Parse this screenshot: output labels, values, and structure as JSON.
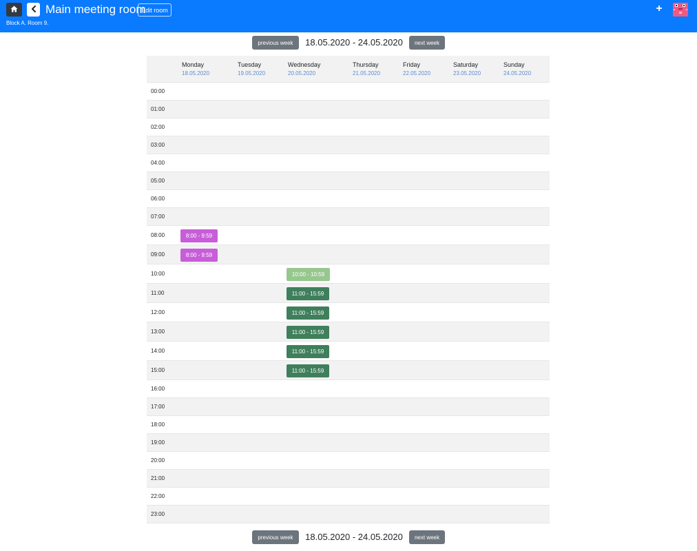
{
  "header": {
    "title": "Main meeting room",
    "edit_label": "Edit room",
    "subtitle": "Block A. Room 9.",
    "add_label": "+",
    "brand_color": "#0a7aff"
  },
  "week": {
    "range": "18.05.2020 - 24.05.2020",
    "prev_label": "previous week",
    "next_label": "next week"
  },
  "days": [
    {
      "name": "Monday",
      "date": "18.05.2020"
    },
    {
      "name": "Tuesday",
      "date": "19.05.2020"
    },
    {
      "name": "Wednesday",
      "date": "20.05.2020"
    },
    {
      "name": "Thursday",
      "date": "21.05.2020"
    },
    {
      "name": "Friday",
      "date": "22.05.2020"
    },
    {
      "name": "Saturday",
      "date": "23.05.2020"
    },
    {
      "name": "Sunday",
      "date": "24.05.2020"
    }
  ],
  "hours": [
    "00:00",
    "01:00",
    "02:00",
    "03:00",
    "04:00",
    "05:00",
    "06:00",
    "07:00",
    "08:00",
    "09:00",
    "10:00",
    "11:00",
    "12:00",
    "13:00",
    "14:00",
    "15:00",
    "16:00",
    "17:00",
    "18:00",
    "19:00",
    "20:00",
    "21:00",
    "22:00",
    "23:00"
  ],
  "events": [
    {
      "day": "Monday",
      "hour": "08:00",
      "label": "8:00 - 9:59",
      "color": "#c75ed8"
    },
    {
      "day": "Monday",
      "hour": "09:00",
      "label": "8:00 - 9:59",
      "color": "#c75ed8"
    },
    {
      "day": "Wednesday",
      "hour": "10:00",
      "label": "10:00 - 10:59",
      "color": "#97c78f"
    },
    {
      "day": "Wednesday",
      "hour": "11:00",
      "label": "11:00 - 15:59",
      "color": "#3f7f5b"
    },
    {
      "day": "Wednesday",
      "hour": "12:00",
      "label": "11:00 - 15:59",
      "color": "#3f7f5b"
    },
    {
      "day": "Wednesday",
      "hour": "13:00",
      "label": "11:00 - 15:59",
      "color": "#3f7f5b"
    },
    {
      "day": "Wednesday",
      "hour": "14:00",
      "label": "11:00 - 15:59",
      "color": "#3f7f5b"
    },
    {
      "day": "Wednesday",
      "hour": "15:00",
      "label": "11:00 - 15:59",
      "color": "#3f7f5b"
    }
  ]
}
